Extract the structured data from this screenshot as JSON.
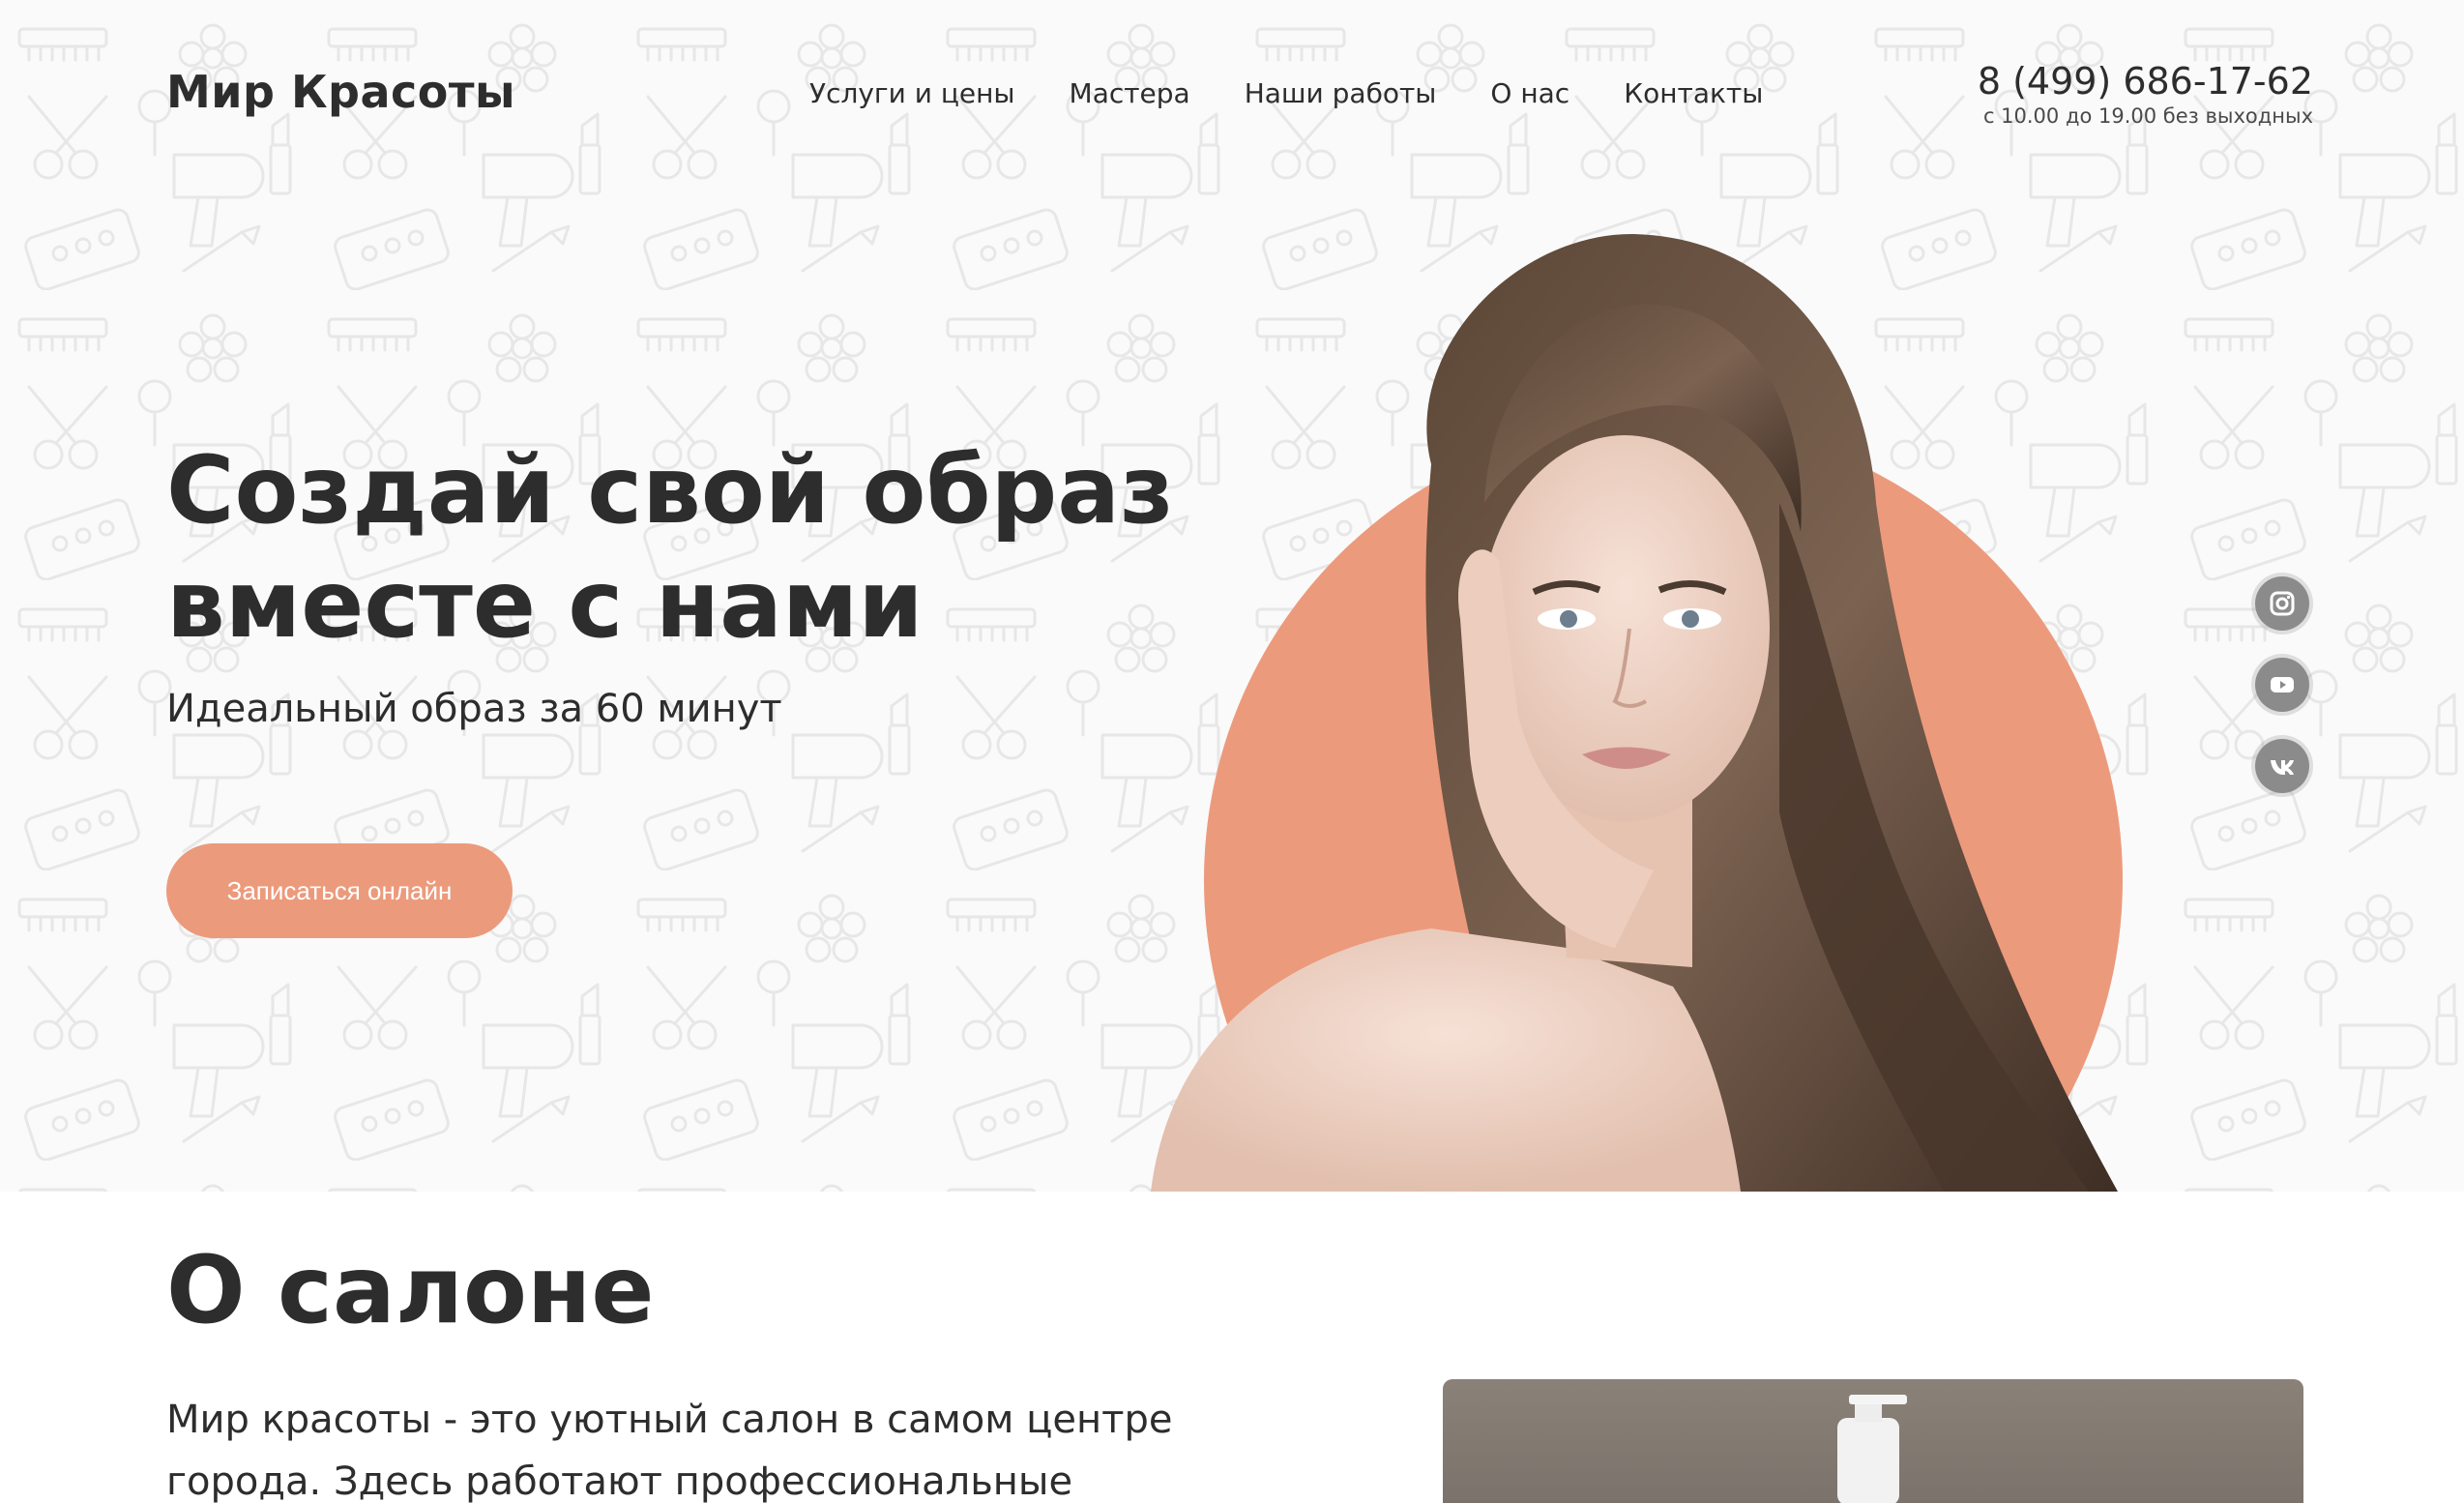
{
  "header": {
    "logo": "Мир Красоты",
    "nav": [
      "Услуги и цены",
      "Мастера",
      "Наши работы",
      "О нас",
      "Контакты"
    ],
    "phone": "8 (499) 686-17-62",
    "hours": "с 10.00 до 19.00 без выходных"
  },
  "hero": {
    "headline": "Создай свой образ вместе с нами",
    "subheadline": "Идеальный образ за 60 минут",
    "cta_label": "Записаться онлайн",
    "accent_color": "#ec9a7c"
  },
  "social": [
    {
      "icon": "instagram-icon"
    },
    {
      "icon": "youtube-icon"
    },
    {
      "icon": "vk-icon"
    }
  ],
  "about": {
    "title": "О салоне",
    "text": "Мир красоты - это уютный салон в самом центре города. Здесь работают профессиональные"
  }
}
